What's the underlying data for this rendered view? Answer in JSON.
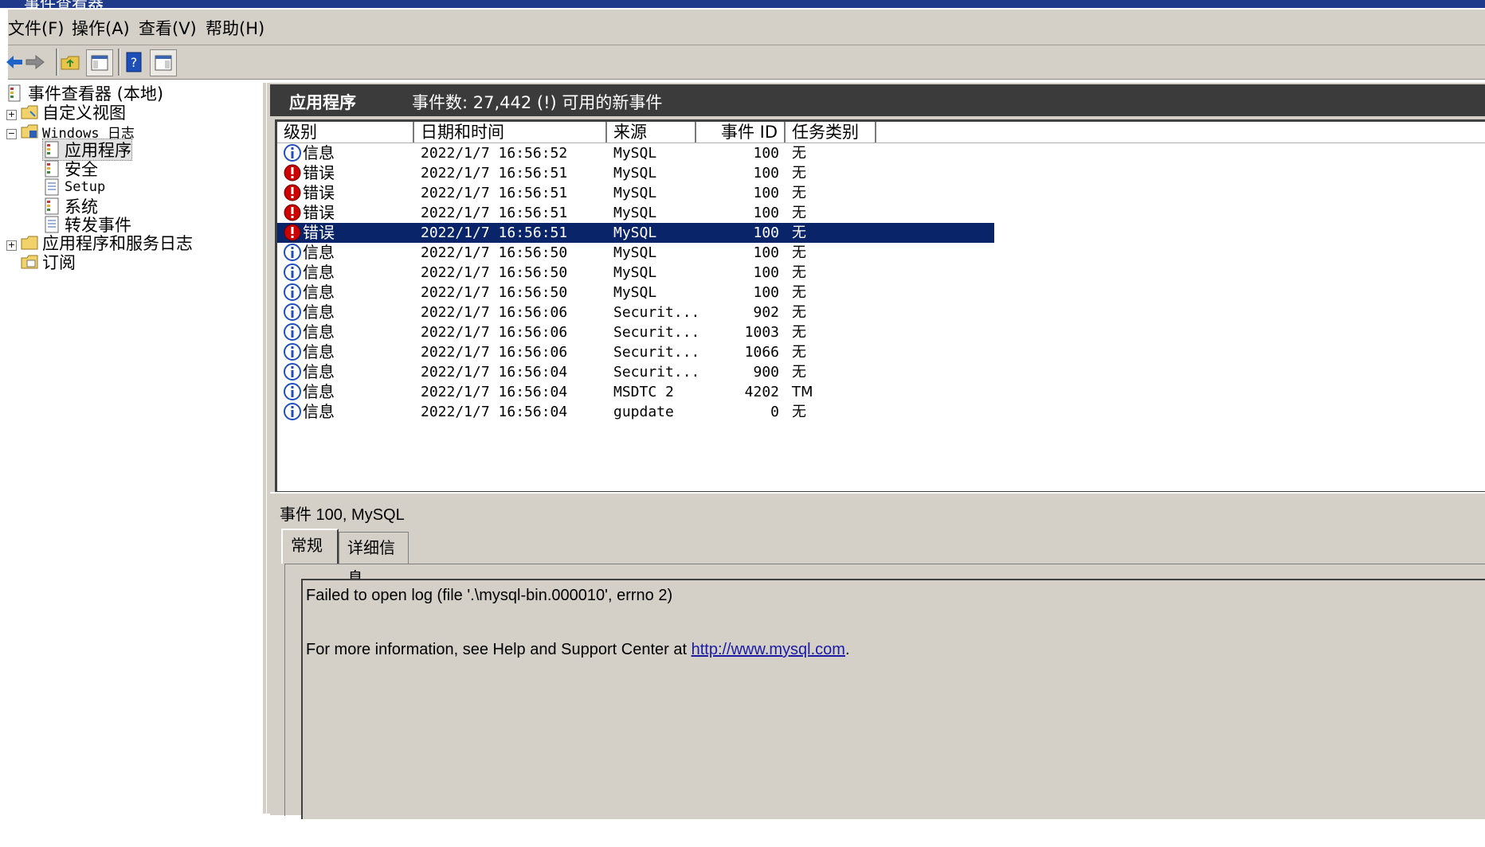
{
  "window": {
    "title": "事件查看器"
  },
  "menu": [
    "文件(F)",
    "操作(A)",
    "查看(V)",
    "帮助(H)"
  ],
  "toolbar": [
    "back-icon",
    "forward-icon",
    "up-folder-icon",
    "show-hide-tree-icon",
    "help-icon",
    "show-hide-action-pane-icon"
  ],
  "tree": {
    "root": "事件查看器 (本地)",
    "custom_views": "自定义视图",
    "windows_logs": "Windows 日志",
    "logs": [
      "应用程序",
      "安全",
      "Setup",
      "系统",
      "转发事件"
    ],
    "app_service_logs": "应用程序和服务日志",
    "subscriptions": "订阅"
  },
  "header": {
    "title": "应用程序",
    "count_text": "事件数: 27,442 (!) 可用的新事件"
  },
  "columns": [
    "级别",
    "日期和时间",
    "来源",
    "事件 ID",
    "任务类别"
  ],
  "events": [
    {
      "level": "信息",
      "kind": "info",
      "datetime": "2022/1/7 16:56:52",
      "source": "MySQL",
      "id": "100",
      "task": "无"
    },
    {
      "level": "错误",
      "kind": "error",
      "datetime": "2022/1/7 16:56:51",
      "source": "MySQL",
      "id": "100",
      "task": "无"
    },
    {
      "level": "错误",
      "kind": "error",
      "datetime": "2022/1/7 16:56:51",
      "source": "MySQL",
      "id": "100",
      "task": "无"
    },
    {
      "level": "错误",
      "kind": "error",
      "datetime": "2022/1/7 16:56:51",
      "source": "MySQL",
      "id": "100",
      "task": "无"
    },
    {
      "level": "错误",
      "kind": "error",
      "datetime": "2022/1/7 16:56:51",
      "source": "MySQL",
      "id": "100",
      "task": "无",
      "selected": true
    },
    {
      "level": "信息",
      "kind": "info",
      "datetime": "2022/1/7 16:56:50",
      "source": "MySQL",
      "id": "100",
      "task": "无"
    },
    {
      "level": "信息",
      "kind": "info",
      "datetime": "2022/1/7 16:56:50",
      "source": "MySQL",
      "id": "100",
      "task": "无"
    },
    {
      "level": "信息",
      "kind": "info",
      "datetime": "2022/1/7 16:56:50",
      "source": "MySQL",
      "id": "100",
      "task": "无"
    },
    {
      "level": "信息",
      "kind": "info",
      "datetime": "2022/1/7 16:56:06",
      "source": "Securit...",
      "id": "902",
      "task": "无"
    },
    {
      "level": "信息",
      "kind": "info",
      "datetime": "2022/1/7 16:56:06",
      "source": "Securit...",
      "id": "1003",
      "task": "无"
    },
    {
      "level": "信息",
      "kind": "info",
      "datetime": "2022/1/7 16:56:06",
      "source": "Securit...",
      "id": "1066",
      "task": "无"
    },
    {
      "level": "信息",
      "kind": "info",
      "datetime": "2022/1/7 16:56:04",
      "source": "Securit...",
      "id": "900",
      "task": "无"
    },
    {
      "level": "信息",
      "kind": "info",
      "datetime": "2022/1/7 16:56:04",
      "source": "MSDTC 2",
      "id": "4202",
      "task": "TM"
    },
    {
      "level": "信息",
      "kind": "info",
      "datetime": "2022/1/7 16:56:04",
      "source": "gupdate",
      "id": "0",
      "task": "无"
    }
  ],
  "detail": {
    "title": "事件 100, MySQL",
    "tabs": [
      "常规",
      "详细信息"
    ],
    "message": "Failed to open log (file '.\\mysql-bin.000010', errno 2)",
    "help_prefix": "For more information, see Help and Support Center at ",
    "help_link": "http://www.mysql.com",
    "help_suffix": "."
  },
  "colors": {
    "selection": "#0a246a",
    "header_bar": "#3b3b3b",
    "error_red": "#cc0000",
    "info_blue": "#1f4fbf"
  }
}
